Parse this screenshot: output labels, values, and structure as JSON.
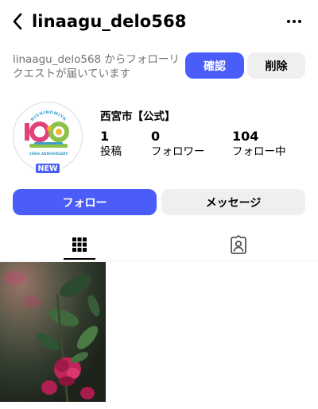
{
  "header": {
    "username": "linaagu_delo568",
    "back_icon": "chevron-left-icon",
    "more_icon": "ellipsis-icon"
  },
  "follow_request": {
    "text": "linaagu_delo568 からフォローリクエストが届いています",
    "confirm_label": "確認",
    "delete_label": "削除"
  },
  "profile": {
    "avatar_badge": "NEW",
    "display_name": "西宮市【公式】",
    "stats": {
      "posts": {
        "value": "1",
        "label": "投稿"
      },
      "followers": {
        "value": "0",
        "label": "フォロワー"
      },
      "following": {
        "value": "104",
        "label": "フォロー中"
      }
    },
    "logo_text": {
      "top": "NISHINOMIYA",
      "number": "100",
      "bottom": "100th ANNIVERSARY"
    }
  },
  "actions": {
    "follow_label": "フォロー",
    "message_label": "メッセージ"
  },
  "tabs": [
    {
      "name": "posts-grid",
      "icon": "grid-icon",
      "active": true
    },
    {
      "name": "tagged",
      "icon": "tagged-person-icon",
      "active": false
    }
  ],
  "colors": {
    "accent": "#4a5df9",
    "secondary_button": "#efefef",
    "muted_text": "#737373"
  }
}
